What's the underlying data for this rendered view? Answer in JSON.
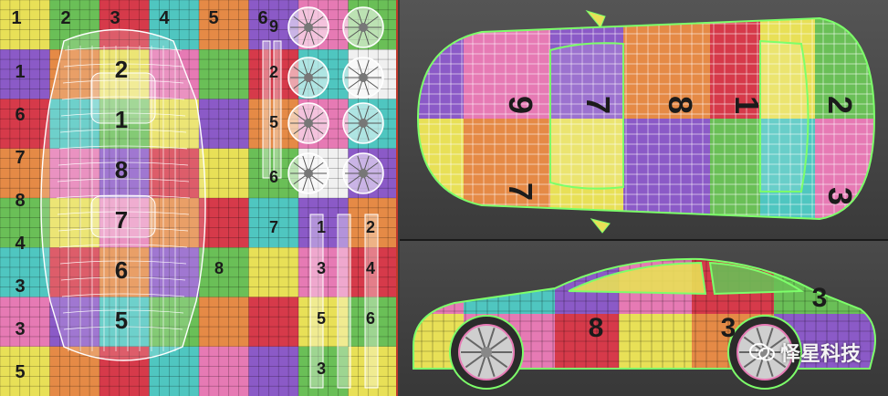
{
  "uv_grid": {
    "palette": [
      "#e8e057",
      "#e58a46",
      "#6abf57",
      "#4fc6c0",
      "#8b5ac7",
      "#e67ab4",
      "#d63a4a",
      "#f0f0f0"
    ],
    "top_row_labels": [
      "1",
      "2",
      "3",
      "4",
      "5",
      "6"
    ],
    "left_column_labels": [
      "1",
      "6",
      "7",
      "8",
      "4",
      "3",
      "3",
      "5"
    ],
    "center_labels": [
      "2",
      "1",
      "8",
      "7",
      "6",
      "5"
    ],
    "right_column_labels": [
      "1",
      "2",
      "3",
      "4",
      "8",
      "9",
      "2",
      "5",
      "5",
      "6",
      "7",
      "6",
      "3"
    ]
  },
  "top_view": {
    "panel_labels": [
      "9",
      "7",
      "8",
      "1",
      "2",
      "7",
      "3"
    ]
  },
  "side_view": {
    "panel_labels": [
      "3",
      "3",
      "8"
    ]
  },
  "watermark": {
    "text": "怿星科技"
  }
}
